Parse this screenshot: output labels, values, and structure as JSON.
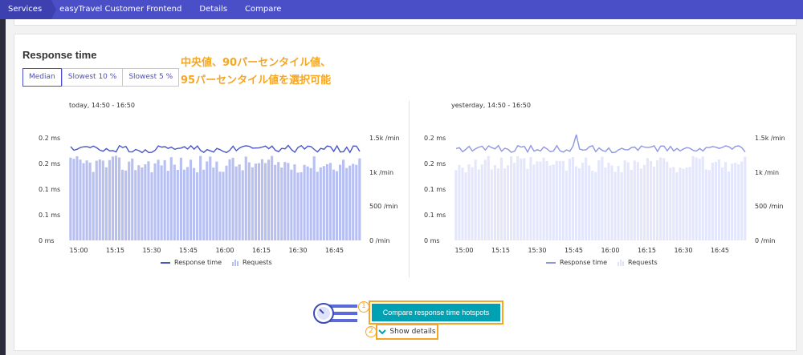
{
  "breadcrumb": [
    "Services",
    "easyTravel Customer Frontend",
    "Details",
    "Compare"
  ],
  "panel": {
    "title": "Response time",
    "percentile_options": [
      "Median",
      "Slowest 10 %",
      "Slowest 5 %"
    ],
    "selected_option": "Median"
  },
  "annotation": {
    "line1": "中央値、90パーセンタイル値、",
    "line2": "95パーセンタイル値を選択可能"
  },
  "charts": {
    "today": {
      "range": "today, 14:50 - 16:50",
      "legend_line": "Response time",
      "legend_bars": "Requests"
    },
    "yesterday": {
      "range": "yesterday, 14:50 - 16:50",
      "legend_line": "Response time",
      "legend_bars": "Requests"
    }
  },
  "axes": {
    "y_left": [
      "0.2 ms",
      "0.2 ms",
      "0.1 ms",
      "0.1 ms",
      "0 ms"
    ],
    "y_right": [
      "1.5k /min",
      "1k /min",
      "500 /min",
      "0 /min"
    ],
    "x_ticks": [
      "15:00",
      "15:15",
      "15:30",
      "15:45",
      "16:00",
      "16:15",
      "16:30",
      "16:45"
    ]
  },
  "colors": {
    "today_line": "#4a56c8",
    "today_bars": "#b8c0f2",
    "yesterday_line": "#8f97e0",
    "yesterday_bars": "#e4e7fb",
    "accent": "#00a1b2",
    "highlight": "#f5a623"
  },
  "actions": {
    "compare_button": "Compare response time hotspots",
    "show_details": "Show details",
    "marker1": "1",
    "marker2": "2"
  }
}
